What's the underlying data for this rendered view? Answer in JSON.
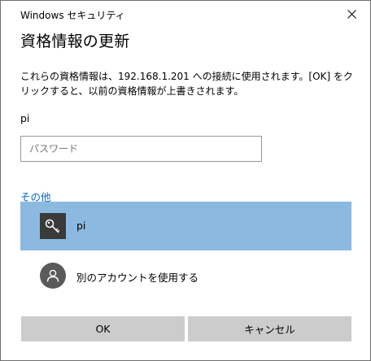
{
  "window": {
    "title": "Windows セキュリティ",
    "close_icon": "close-icon"
  },
  "dialog": {
    "heading": "資格情報の更新",
    "description": "これらの資格情報は、192.168.1.201 への接続に使用されます。[OK] をクリックすると、以前の資格情報が上書きされます。",
    "username": "pi",
    "password": {
      "value": "",
      "placeholder": "パスワード"
    },
    "other_label": "その他",
    "accounts": [
      {
        "label": "pi",
        "icon": "key-icon",
        "selected": true
      },
      {
        "label": "別のアカウントを使用する",
        "icon": "user-icon",
        "selected": false
      }
    ]
  },
  "buttons": {
    "ok": "OK",
    "cancel": "キャンセル"
  },
  "colors": {
    "selected_bg": "#8cb9e0",
    "link": "#0066cc",
    "button_bg": "#cccccc"
  }
}
